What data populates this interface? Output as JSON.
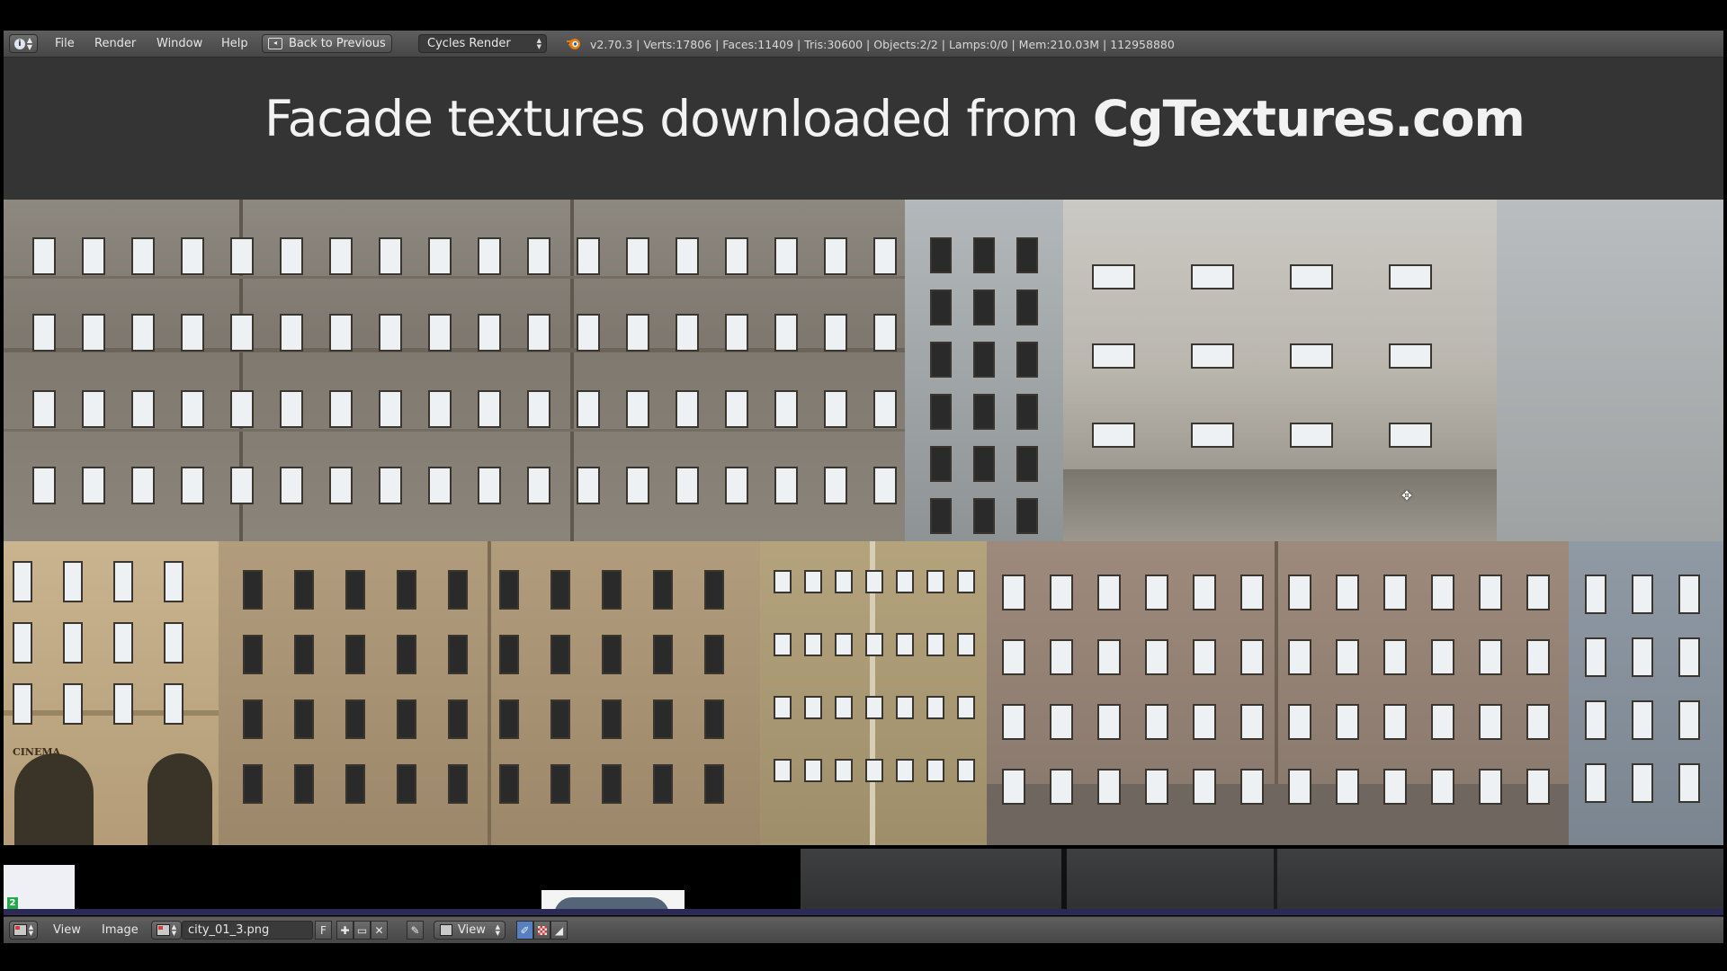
{
  "header": {
    "menu": [
      "File",
      "Render",
      "Window",
      "Help"
    ],
    "back_button": "Back to Previous",
    "render_engine": "Cycles Render",
    "stats": "v2.70.3 | Verts:17806 | Faces:11409 | Tris:30600 | Objects:2/2 | Lamps:0/0 | Mem:210.03M | 112958880"
  },
  "image": {
    "banner_prefix": "Facade textures downloaded from",
    "banner_brand": "CgTextures.com",
    "signage": "CINEMA",
    "layer_number": "2"
  },
  "footer": {
    "menu": [
      "View",
      "Image"
    ],
    "image_name": "city_01_3.png",
    "fake_user": "F",
    "view_label": "View"
  },
  "icons": {
    "info": "info-icon",
    "blender": "blender-logo-icon",
    "back": "back-icon",
    "editor_type": "image-editor-icon",
    "add": "plus-icon",
    "open": "folder-icon",
    "unlink": "close-icon",
    "pin": "pin-icon",
    "move_cursor": "move-cursor-icon"
  },
  "colors": {
    "header_bg": "#4f4f4f",
    "banner_bg": "#343434",
    "brand_orange": "#e87d0d",
    "active_toggle": "#5680c2"
  }
}
